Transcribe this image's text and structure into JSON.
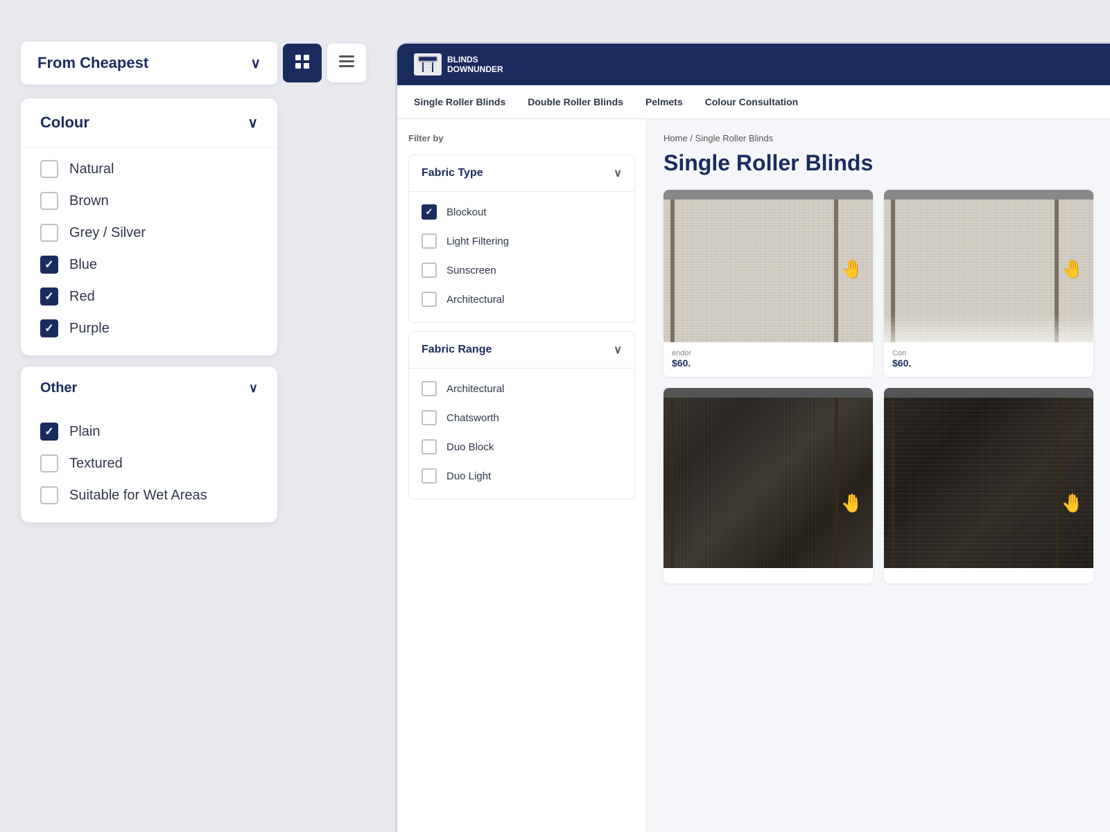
{
  "page": {
    "background_color": "#e8eaf0"
  },
  "sort": {
    "label": "From Cheapest",
    "chevron": "∨"
  },
  "view_buttons": {
    "grid_label": "⊞",
    "list_label": "≡"
  },
  "colour_filter": {
    "title": "Colour",
    "chevron": "∨",
    "items": [
      {
        "label": "Natural",
        "checked": false
      },
      {
        "label": "Brown",
        "checked": false
      },
      {
        "label": "Grey / Silver",
        "checked": false
      },
      {
        "label": "Blue",
        "checked": true
      },
      {
        "label": "Red",
        "checked": true
      },
      {
        "label": "Purple",
        "checked": true
      }
    ]
  },
  "other_filter": {
    "title": "Other",
    "chevron": "∨",
    "items": [
      {
        "label": "Plain",
        "checked": true
      },
      {
        "label": "Textured",
        "checked": false
      },
      {
        "label": "Suitable for Wet Areas",
        "checked": false
      }
    ]
  },
  "site": {
    "logo_text_line1": "BLINDS",
    "logo_text_line2": "DOWNUNDER",
    "nav_items": [
      "Single Roller Blinds",
      "Double Roller Blinds",
      "Pelmets",
      "Colour Consultation"
    ]
  },
  "breadcrumb": {
    "home": "Home",
    "separator": "/",
    "current": "Single Roller Blinds"
  },
  "page_title": "Single Roller Blinds",
  "filter_by_label": "Filter by",
  "fabric_type_filter": {
    "title": "Fabric Type",
    "chevron": "∨",
    "items": [
      {
        "label": "Blockout",
        "checked": true
      },
      {
        "label": "Light Filtering",
        "checked": false
      },
      {
        "label": "Sunscreen",
        "checked": false
      },
      {
        "label": "Architectural",
        "checked": false
      }
    ]
  },
  "fabric_range_filter": {
    "title": "Fabric Range",
    "chevron": "∨",
    "items": [
      {
        "label": "Architectural",
        "checked": false
      },
      {
        "label": "Chatsworth",
        "checked": false
      },
      {
        "label": "Duo Block",
        "checked": false
      },
      {
        "label": "Duo Light",
        "checked": false
      }
    ]
  },
  "products": [
    {
      "vendor": "endor",
      "price": "$60.",
      "type": "light"
    },
    {
      "vendor": "Con",
      "price": "$60.",
      "type": "light"
    },
    {
      "vendor": "",
      "price": "",
      "type": "dark"
    },
    {
      "vendor": "",
      "price": "",
      "type": "dark"
    }
  ]
}
